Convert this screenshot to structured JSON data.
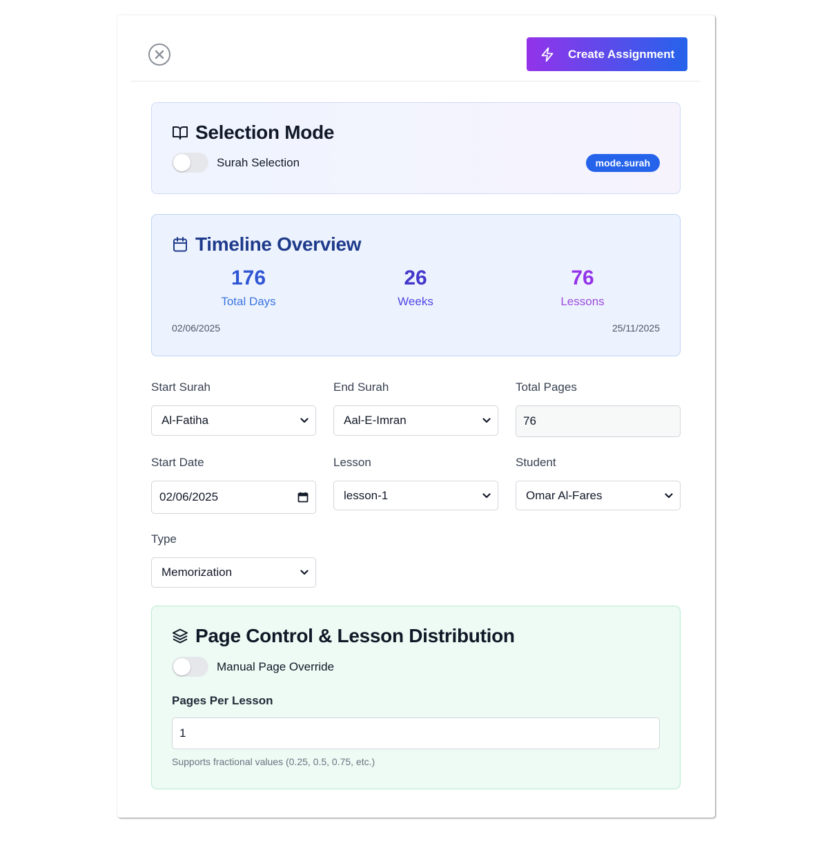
{
  "header": {
    "create_label": "Create Assignment"
  },
  "selection_mode": {
    "title": "Selection Mode",
    "toggle_label": "Surah Selection",
    "toggle_on": false,
    "badge": "mode.surah"
  },
  "timeline": {
    "title": "Timeline Overview",
    "total_days": "176",
    "total_days_label": "Total Days",
    "weeks": "26",
    "weeks_label": "Weeks",
    "lessons": "76",
    "lessons_label": "Lessons",
    "start_date": "02/06/2025",
    "end_date": "25/11/2025"
  },
  "form": {
    "start_surah": {
      "label": "Start Surah",
      "value": "Al-Fatiha"
    },
    "end_surah": {
      "label": "End Surah",
      "value": "Aal-E-Imran"
    },
    "total_pages": {
      "label": "Total Pages",
      "value": "76"
    },
    "start_date": {
      "label": "Start Date",
      "value": "02/06/2025"
    },
    "lesson": {
      "label": "Lesson",
      "value": "lesson-1"
    },
    "student": {
      "label": "Student",
      "value": "Omar Al-Fares"
    },
    "type": {
      "label": "Type",
      "value": "Memorization"
    }
  },
  "page_control": {
    "title": "Page Control & Lesson Distribution",
    "toggle_label": "Manual Page Override",
    "toggle_on": false,
    "pages_per_lesson_label": "Pages Per Lesson",
    "pages_per_lesson_value": "1",
    "hint": "Supports fractional values (0.25, 0.5, 0.75, etc.)"
  },
  "colors": {
    "primary_gradient_start": "#9333ea",
    "primary_gradient_end": "#2563eb",
    "badge": "#2563eb",
    "timeline_title": "#1e3a8a"
  },
  "icons": [
    "close-icon",
    "lightning-icon",
    "book-open-icon",
    "calendar-icon",
    "chevron-down-icon",
    "layers-icon"
  ]
}
